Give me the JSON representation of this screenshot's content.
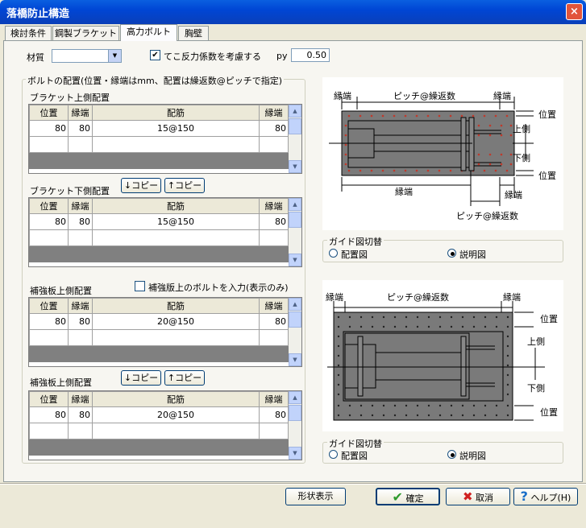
{
  "window": {
    "title": "落橋防止構造",
    "close_symbol": "×"
  },
  "tabs": [
    {
      "label": "検討条件"
    },
    {
      "label": "鋼製ブラケット"
    },
    {
      "label": "高力ボルト",
      "active": true
    },
    {
      "label": "胸壁"
    }
  ],
  "top": {
    "material_label": "材質",
    "material_value": "",
    "checkbox_label": "てこ反力係数を考慮する",
    "checkbox_checked": true,
    "check_mark": "✔",
    "py_label": "py",
    "py_value": "0.50"
  },
  "bolt_group": {
    "title": "ボルトの配置(位置・縁端はmm、配置は繰返数@ピッチで指定)"
  },
  "grid_headers": [
    "位置",
    "縁端",
    "配筋",
    "縁端"
  ],
  "sections": [
    {
      "label": "ブラケット上側配置",
      "row": [
        "80",
        "80",
        "15@150",
        "80"
      ]
    },
    {
      "label": "ブラケット下側配置",
      "row": [
        "80",
        "80",
        "15@150",
        "80"
      ],
      "copy_down": "↓コピー",
      "copy_up": "↑コピー"
    },
    {
      "label": "補強板上側配置",
      "row": [
        "80",
        "80",
        "20@150",
        "80"
      ],
      "checkbox_label": "補強版上のボルトを入力(表示のみ)",
      "checkbox_checked": false
    },
    {
      "label": "補強板上側配置",
      "row": [
        "80",
        "80",
        "20@150",
        "80"
      ],
      "copy_down": "↓コピー",
      "copy_up": "↑コピー"
    }
  ],
  "diagram1": {
    "edge_left": "縁端",
    "pitch_top": "ピッチ@繰返数",
    "edge_right": "縁端",
    "pos_top": "位置",
    "upper": "上側",
    "lower": "下側",
    "pos_bottom": "位置",
    "edge_bottom": "縁端",
    "edge_bottom_right": "縁端",
    "pitch_bottom": "ピッチ@繰返数"
  },
  "guide1": {
    "title": "ガイド図切替",
    "option1": "配置図",
    "option2": "説明図",
    "selected": "説明図"
  },
  "diagram2": {
    "edge_left": "縁端",
    "pitch_top": "ピッチ@繰返数",
    "edge_right": "縁端",
    "pos_top": "位置",
    "upper": "上側",
    "lower": "下側",
    "pos_bottom": "位置"
  },
  "guide2": {
    "title": "ガイド図切替",
    "option1": "配置図",
    "option2": "説明図",
    "selected": "説明図"
  },
  "footer": {
    "shape_button": "形状表示",
    "ok_button": "確定",
    "cancel_button": "取消",
    "help_button": "ヘルプ(H)"
  },
  "colors": {
    "titlebar": "#0046d5",
    "plate_fill": "#777777",
    "bolt_dot": "#c0392b",
    "ok_icon": "#2e9a2e",
    "cancel_icon": "#d02020",
    "help_icon": "#1a6ec8"
  }
}
